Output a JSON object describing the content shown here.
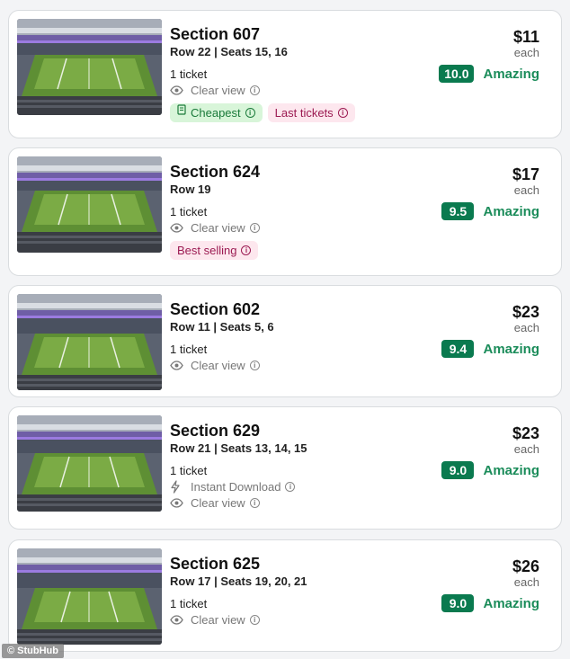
{
  "listings": [
    {
      "section": "Section 607",
      "row_seats": "Row 22 | Seats 15, 16",
      "qty": "1 ticket",
      "features": [
        {
          "icon": "eye-icon",
          "label": "Clear view"
        }
      ],
      "badges": [
        {
          "label": "Cheapest",
          "style": "green",
          "icon": "ticket-icon"
        },
        {
          "label": "Last tickets",
          "style": "pink"
        }
      ],
      "price": "$11",
      "price_unit": "each",
      "score": "10.0",
      "rating_label": "Amazing"
    },
    {
      "section": "Section 624",
      "row_seats": "Row 19",
      "qty": "1 ticket",
      "features": [
        {
          "icon": "eye-icon",
          "label": "Clear view"
        }
      ],
      "badges": [
        {
          "label": "Best selling",
          "style": "pink"
        }
      ],
      "price": "$17",
      "price_unit": "each",
      "score": "9.5",
      "rating_label": "Amazing"
    },
    {
      "section": "Section 602",
      "row_seats": "Row 11 | Seats 5, 6",
      "qty": "1 ticket",
      "features": [
        {
          "icon": "eye-icon",
          "label": "Clear view"
        }
      ],
      "badges": [],
      "price": "$23",
      "price_unit": "each",
      "score": "9.4",
      "rating_label": "Amazing"
    },
    {
      "section": "Section 629",
      "row_seats": "Row 21 | Seats 13, 14, 15",
      "qty": "1 ticket",
      "features": [
        {
          "icon": "lightning-icon",
          "label": "Instant Download"
        },
        {
          "icon": "eye-icon",
          "label": "Clear view"
        }
      ],
      "badges": [],
      "price": "$23",
      "price_unit": "each",
      "score": "9.0",
      "rating_label": "Amazing"
    },
    {
      "section": "Section 625",
      "row_seats": "Row 17 | Seats 19, 20, 21",
      "qty": "1 ticket",
      "features": [
        {
          "icon": "eye-icon",
          "label": "Clear view"
        }
      ],
      "badges": [],
      "price": "$26",
      "price_unit": "each",
      "score": "9.0",
      "rating_label": "Amazing"
    }
  ],
  "watermark": "© StubHub",
  "colors": {
    "score_bg": "#0a7a4f",
    "rating_text": "#1b8c5a",
    "badge_green_bg": "#d8f5d9",
    "badge_pink_bg": "#fde7ee"
  }
}
